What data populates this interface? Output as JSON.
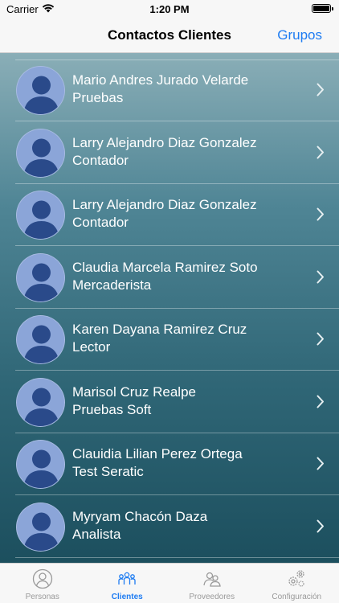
{
  "status_bar": {
    "carrier": "Carrier",
    "time": "1:20 PM"
  },
  "nav": {
    "title": "Contactos Clientes",
    "right_button": "Grupos"
  },
  "contacts": [
    {
      "name": "Mario Andres Jurado Velarde",
      "role": "Pruebas"
    },
    {
      "name": "Larry Alejandro Diaz Gonzalez",
      "role": "Contador"
    },
    {
      "name": "Larry Alejandro Diaz Gonzalez",
      "role": "Contador"
    },
    {
      "name": "Claudia Marcela Ramirez Soto",
      "role": "Mercaderista"
    },
    {
      "name": "Karen Dayana Ramirez Cruz",
      "role": "Lector"
    },
    {
      "name": "Marisol Cruz Realpe",
      "role": "Pruebas Soft"
    },
    {
      "name": "Clauidia Lilian Perez Ortega",
      "role": "Test Seratic"
    },
    {
      "name": "Myryam Chacón Daza",
      "role": "Analista"
    }
  ],
  "tabs": [
    {
      "label": "Personas",
      "icon": "person-icon",
      "active": false
    },
    {
      "label": "Clientes",
      "icon": "people-group-icon",
      "active": true
    },
    {
      "label": "Proveedores",
      "icon": "providers-icon",
      "active": false
    },
    {
      "label": "Configuración",
      "icon": "gears-icon",
      "active": false
    }
  ],
  "colors": {
    "accent": "#1e7cf2",
    "avatar_bg": "#8ba5d8",
    "avatar_silhouette": "#2a4a8a",
    "inactive_tab": "#9a9a9a"
  }
}
